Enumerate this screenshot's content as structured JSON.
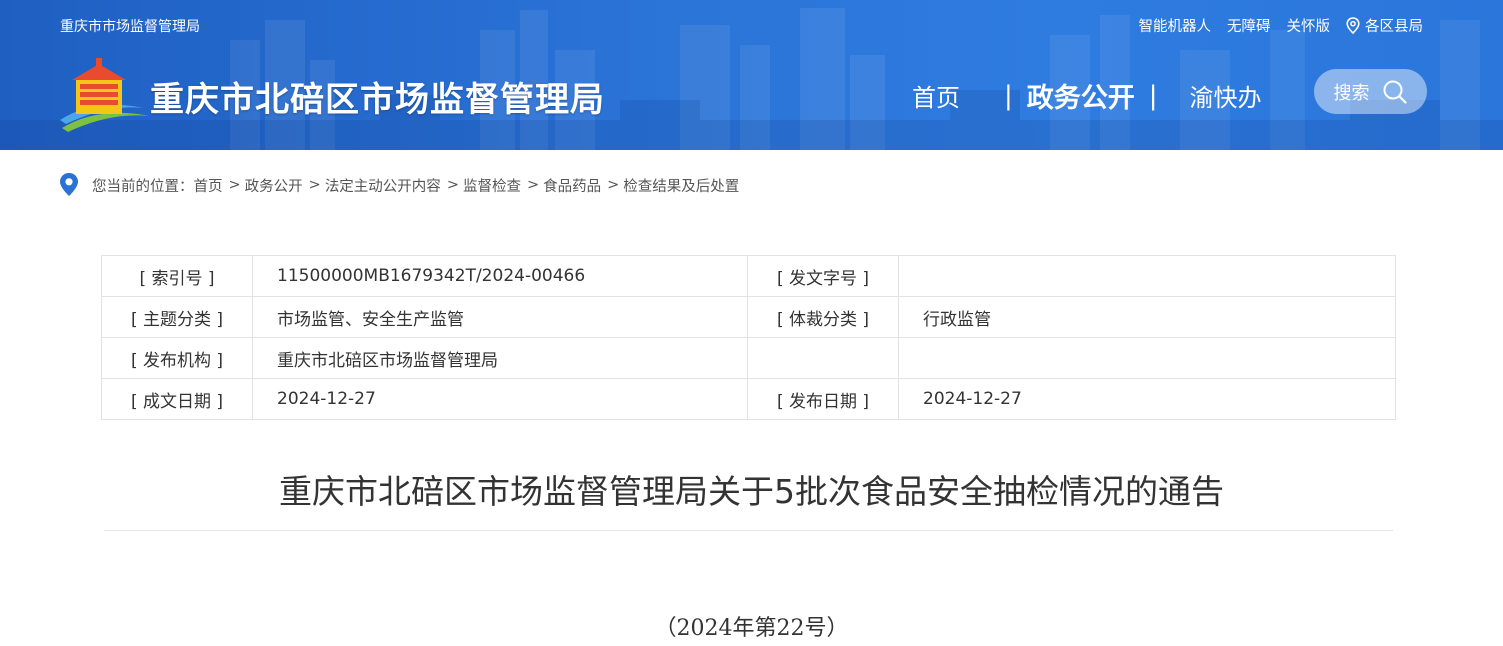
{
  "header": {
    "org_short": "重庆市市场监督管理局",
    "top_links": [
      "智能机器人",
      "无障碍",
      "关怀版"
    ],
    "region_label": "各区县局",
    "site_title": "重庆市北碚区市场监督管理局",
    "nav": {
      "home": "首页",
      "gov_open": "政务公开",
      "yukuaiban": "渝快办"
    },
    "search_label": "搜索"
  },
  "breadcrumb": {
    "prefix": "您当前的位置：",
    "items": [
      "首页",
      "政务公开",
      "法定主动公开内容",
      "监督检查",
      "食品药品",
      "检查结果及后处置"
    ]
  },
  "meta": {
    "rows": [
      {
        "l1": "[ 索引号 ]",
        "v1": "11500000MB1679342T/2024-00466",
        "l2": "[ 发文字号 ]",
        "v2": ""
      },
      {
        "l1": "[ 主题分类 ]",
        "v1": "市场监管、安全生产监管",
        "l2": "[ 体裁分类 ]",
        "v2": "行政监管"
      },
      {
        "l1": "[ 发布机构 ]",
        "v1": "重庆市北碚区市场监督管理局",
        "l2": "",
        "v2": ""
      },
      {
        "l1": "[ 成文日期 ]",
        "v1": "2024-12-27",
        "l2": "[ 发布日期 ]",
        "v2": "2024-12-27"
      }
    ]
  },
  "article": {
    "title": "重庆市北碚区市场监督管理局关于5批次食品安全抽检情况的通告",
    "doc_number": "（2024年第22号）"
  },
  "colors": {
    "header_blue": "#2a72d6",
    "border": "#e3e3e3"
  }
}
